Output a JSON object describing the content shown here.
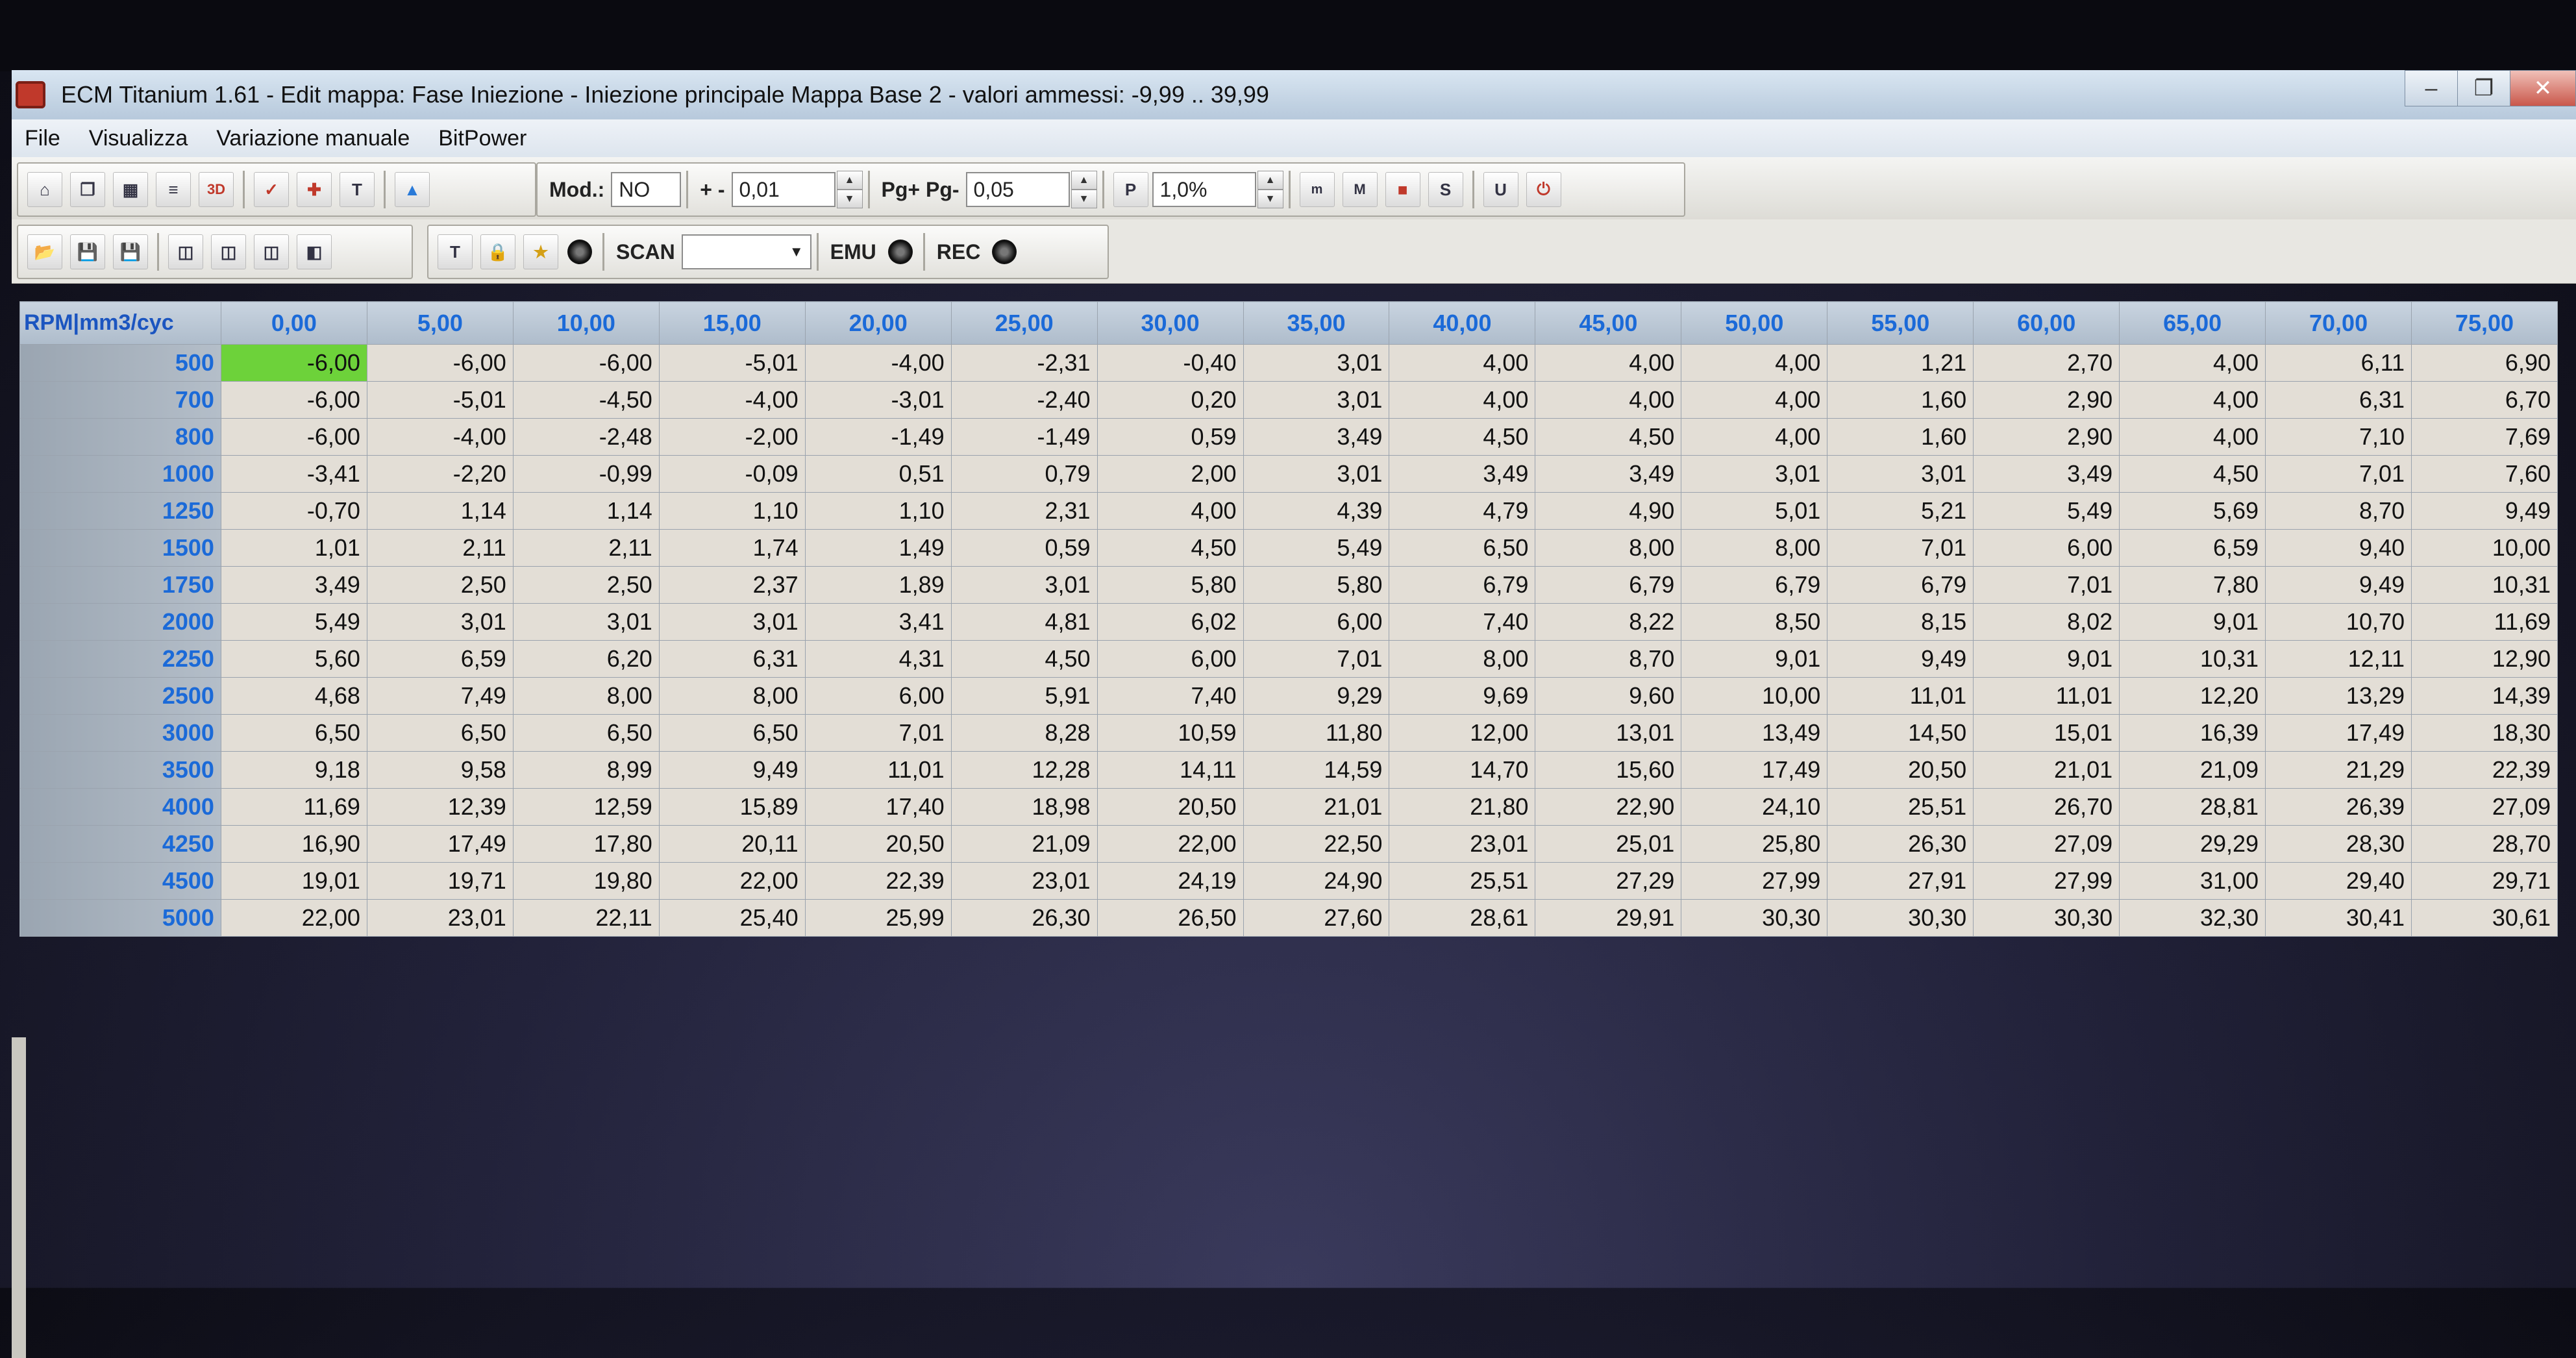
{
  "window": {
    "title": "ECM Titanium 1.61 - Edit mappa: Fase Iniezione - Iniezione principale Mappa Base 2 - valori ammessi: -9,99 .. 39,99",
    "controls": [
      "minimize-icon",
      "restore-icon",
      "close-icon"
    ]
  },
  "menu": [
    "File",
    "Visualizza",
    "Variazione manuale",
    "BitPower"
  ],
  "toolbar1": {
    "mod_label": "Mod.:",
    "mod_value": "NO",
    "plusminus_label": "+ -",
    "plusminus_value": "0,01",
    "pg_label": "Pg+ Pg-",
    "pg_value": "0,05",
    "percent_value": "1,0%"
  },
  "toolbar2": {
    "scan_label": "SCAN",
    "scan_value": "",
    "emu_label": "EMU",
    "rec_label": "REC"
  },
  "grid": {
    "corner": "RPM|mm3/cyc",
    "columns": [
      "0,00",
      "5,00",
      "10,00",
      "15,00",
      "20,00",
      "25,00",
      "30,00",
      "35,00",
      "40,00",
      "45,00",
      "50,00",
      "55,00",
      "60,00",
      "65,00",
      "70,00",
      "75,00"
    ],
    "rows": [
      {
        "rpm": "500",
        "values": [
          "-6,00",
          "-6,00",
          "-6,00",
          "-5,01",
          "-4,00",
          "-2,31",
          "-0,40",
          "3,01",
          "4,00",
          "4,00",
          "4,00",
          "1,21",
          "2,70",
          "4,00",
          "6,11",
          "6,90"
        ]
      },
      {
        "rpm": "700",
        "values": [
          "-6,00",
          "-5,01",
          "-4,50",
          "-4,00",
          "-3,01",
          "-2,40",
          "0,20",
          "3,01",
          "4,00",
          "4,00",
          "4,00",
          "1,60",
          "2,90",
          "4,00",
          "6,31",
          "6,70"
        ]
      },
      {
        "rpm": "800",
        "values": [
          "-6,00",
          "-4,00",
          "-2,48",
          "-2,00",
          "-1,49",
          "-1,49",
          "0,59",
          "3,49",
          "4,50",
          "4,50",
          "4,00",
          "1,60",
          "2,90",
          "4,00",
          "7,10",
          "7,69"
        ]
      },
      {
        "rpm": "1000",
        "values": [
          "-3,41",
          "-2,20",
          "-0,99",
          "-0,09",
          "0,51",
          "0,79",
          "2,00",
          "3,01",
          "3,49",
          "3,49",
          "3,01",
          "3,01",
          "3,49",
          "4,50",
          "7,01",
          "7,60"
        ]
      },
      {
        "rpm": "1250",
        "values": [
          "-0,70",
          "1,14",
          "1,14",
          "1,10",
          "1,10",
          "2,31",
          "4,00",
          "4,39",
          "4,79",
          "4,90",
          "5,01",
          "5,21",
          "5,49",
          "5,69",
          "8,70",
          "9,49"
        ]
      },
      {
        "rpm": "1500",
        "values": [
          "1,01",
          "2,11",
          "2,11",
          "1,74",
          "1,49",
          "0,59",
          "4,50",
          "5,49",
          "6,50",
          "8,00",
          "8,00",
          "7,01",
          "6,00",
          "6,59",
          "9,40",
          "10,00"
        ]
      },
      {
        "rpm": "1750",
        "values": [
          "3,49",
          "2,50",
          "2,50",
          "2,37",
          "1,89",
          "3,01",
          "5,80",
          "5,80",
          "6,79",
          "6,79",
          "6,79",
          "6,79",
          "7,01",
          "7,80",
          "9,49",
          "10,31"
        ]
      },
      {
        "rpm": "2000",
        "values": [
          "5,49",
          "3,01",
          "3,01",
          "3,01",
          "3,41",
          "4,81",
          "6,02",
          "6,00",
          "7,40",
          "8,22",
          "8,50",
          "8,15",
          "8,02",
          "9,01",
          "10,70",
          "11,69"
        ]
      },
      {
        "rpm": "2250",
        "values": [
          "5,60",
          "6,59",
          "6,20",
          "6,31",
          "4,31",
          "4,50",
          "6,00",
          "7,01",
          "8,00",
          "8,70",
          "9,01",
          "9,49",
          "9,01",
          "10,31",
          "12,11",
          "12,90"
        ]
      },
      {
        "rpm": "2500",
        "values": [
          "4,68",
          "7,49",
          "8,00",
          "8,00",
          "6,00",
          "5,91",
          "7,40",
          "9,29",
          "9,69",
          "9,60",
          "10,00",
          "11,01",
          "11,01",
          "12,20",
          "13,29",
          "14,39"
        ]
      },
      {
        "rpm": "3000",
        "values": [
          "6,50",
          "6,50",
          "6,50",
          "6,50",
          "7,01",
          "8,28",
          "10,59",
          "11,80",
          "12,00",
          "13,01",
          "13,49",
          "14,50",
          "15,01",
          "16,39",
          "17,49",
          "18,30"
        ]
      },
      {
        "rpm": "3500",
        "values": [
          "9,18",
          "9,58",
          "8,99",
          "9,49",
          "11,01",
          "12,28",
          "14,11",
          "14,59",
          "14,70",
          "15,60",
          "17,49",
          "20,50",
          "21,01",
          "21,09",
          "21,29",
          "22,39"
        ]
      },
      {
        "rpm": "4000",
        "values": [
          "11,69",
          "12,39",
          "12,59",
          "15,89",
          "17,40",
          "18,98",
          "20,50",
          "21,01",
          "21,80",
          "22,90",
          "24,10",
          "25,51",
          "26,70",
          "28,81",
          "26,39",
          "27,09"
        ]
      },
      {
        "rpm": "4250",
        "values": [
          "16,90",
          "17,49",
          "17,80",
          "20,11",
          "20,50",
          "21,09",
          "22,00",
          "22,50",
          "23,01",
          "25,01",
          "25,80",
          "26,30",
          "27,09",
          "29,29",
          "28,30",
          "28,70"
        ]
      },
      {
        "rpm": "4500",
        "values": [
          "19,01",
          "19,71",
          "19,80",
          "22,00",
          "22,39",
          "23,01",
          "24,19",
          "24,90",
          "25,51",
          "27,29",
          "27,99",
          "27,91",
          "27,99",
          "31,00",
          "29,40",
          "29,71"
        ]
      },
      {
        "rpm": "5000",
        "values": [
          "22,00",
          "23,01",
          "22,11",
          "25,40",
          "25,99",
          "26,30",
          "26,50",
          "27,60",
          "28,61",
          "29,91",
          "30,30",
          "30,30",
          "30,30",
          "32,30",
          "30,41",
          "30,61"
        ]
      }
    ]
  },
  "colors": {
    "selected_cell": "#6dd23a",
    "header_text": "#1b6ad8"
  }
}
